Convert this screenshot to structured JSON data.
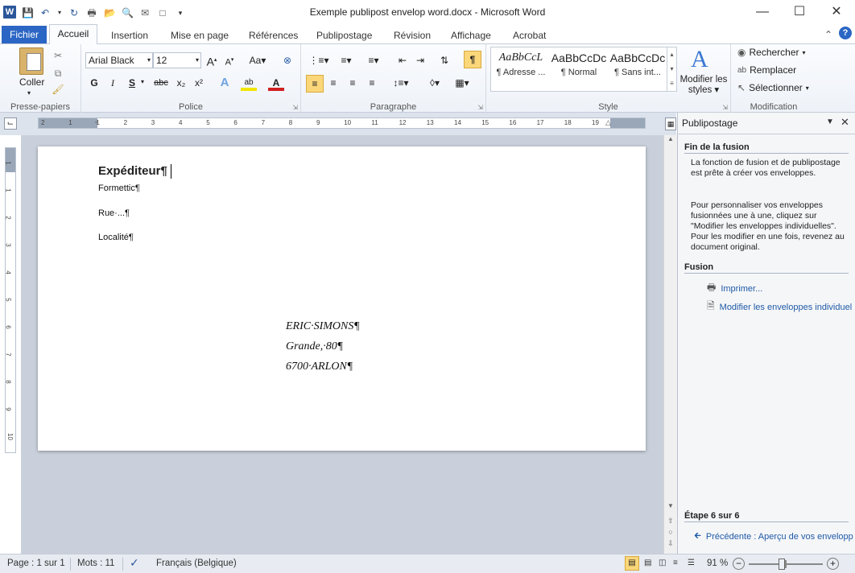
{
  "window": {
    "title": "Exemple publipost envelop word.docx - Microsoft Word",
    "logo_letter": "W"
  },
  "tabs": {
    "file": "Fichier",
    "items": [
      "Accueil",
      "Insertion",
      "Mise en page",
      "Références",
      "Publipostage",
      "Révision",
      "Affichage",
      "Acrobat"
    ]
  },
  "ribbon": {
    "clipboard": {
      "paste": "Coller",
      "label": "Presse-papiers"
    },
    "font": {
      "name": "Arial Black",
      "size": "12",
      "label": "Police",
      "bold": "G",
      "italic": "I",
      "underline": "S",
      "strike": "abc",
      "sub": "x₂",
      "sup": "x²",
      "case": "Aa"
    },
    "paragraph": {
      "label": "Paragraphe",
      "show_marks": "¶"
    },
    "styles": {
      "label": "Style",
      "items": [
        {
          "preview": "AaBbCcL",
          "name": "¶ Adresse ..."
        },
        {
          "preview": "AaBbCcDc",
          "name": "¶ Normal"
        },
        {
          "preview": "AaBbCcDc",
          "name": "¶ Sans int..."
        }
      ],
      "change": "Modifier les styles"
    },
    "editing": {
      "find": "Rechercher",
      "replace": "Remplacer",
      "select": "Sélectionner",
      "label": "Modification"
    }
  },
  "ruler": {
    "numbers": [
      "2",
      "1",
      "1",
      "2",
      "3",
      "4",
      "5",
      "6",
      "7",
      "8",
      "9",
      "10",
      "11",
      "12",
      "13",
      "14",
      "15",
      "16",
      "17",
      "18",
      "19"
    ],
    "vnumbers": [
      "1",
      "1",
      "2",
      "3",
      "4",
      "5",
      "6",
      "7",
      "8",
      "9",
      "10"
    ]
  },
  "document": {
    "sender_title": "Expéditeur¶",
    "sender_lines": [
      "Formettic¶",
      "Rue·...¶",
      "Localité¶"
    ],
    "address_lines": [
      "ERIC·SIMONS¶",
      "Grande,·80¶",
      "6700·ARLON¶"
    ]
  },
  "task_pane": {
    "title": "Publipostage",
    "section1": "Fin de la fusion",
    "para1": "La fonction de fusion et de publipostage est  prête à créer vos enveloppes.",
    "para2": "Pour personnaliser vos enveloppes fusionnées une à une, cliquez sur \"Modifier les enveloppes individuelles\". Pour les modifier en une fois, revenez au document original.",
    "section2": "Fusion",
    "link_print": "Imprimer...",
    "link_edit": "Modifier les enveloppes individuel",
    "step": "Étape 6 sur 6",
    "prev": "Précédente : Aperçu de vos envelopp"
  },
  "status": {
    "page": "Page : 1 sur 1",
    "words": "Mots : 11",
    "lang": "Français (Belgique)",
    "zoom": "91 %",
    "zoom_level": 0.91
  },
  "colors": {
    "accent": "#2b579a",
    "file_tab": "#2b66c4",
    "link": "#1f5aa6"
  }
}
